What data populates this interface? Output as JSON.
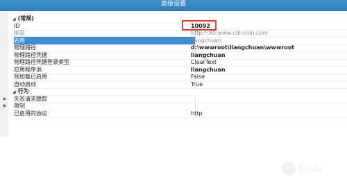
{
  "window": {
    "title": "高级设置"
  },
  "properties": [
    {
      "kind": "category",
      "name": "(常规)"
    },
    {
      "kind": "prop",
      "name": "ID",
      "value": "10092",
      "style": "bold"
    },
    {
      "kind": "prop",
      "name": "绑定",
      "value": "http:*:80:www.cdl-cnln.com",
      "style": "dim",
      "nameStyle": "dim"
    },
    {
      "kind": "prop",
      "name": "名称",
      "value": "liangchuan",
      "style": "dim",
      "selected": true
    },
    {
      "kind": "prop",
      "name": "物理路径",
      "value": "d:\\wwwroot\\liangchuan\\wwwroot",
      "style": "bold"
    },
    {
      "kind": "prop",
      "name": "物理路径凭据",
      "value": "liangchuan",
      "style": "bold"
    },
    {
      "kind": "prop",
      "name": "物理路径凭据登录类型",
      "value": "ClearText"
    },
    {
      "kind": "prop",
      "name": "应用程序池",
      "value": "liangchuan",
      "style": "bold"
    },
    {
      "kind": "prop",
      "name": "预加载已启用",
      "value": "False"
    },
    {
      "kind": "prop",
      "name": "自动启动",
      "value": "True"
    },
    {
      "kind": "category",
      "name": "行为"
    },
    {
      "kind": "prop",
      "name": "失败请求跟踪",
      "value": "",
      "expandable": true
    },
    {
      "kind": "prop",
      "name": "限制",
      "value": "",
      "expandable": true
    },
    {
      "kind": "prop",
      "name": "已启用的协议",
      "value": "http"
    }
  ],
  "watermark": {
    "text": "Baidu经验"
  }
}
